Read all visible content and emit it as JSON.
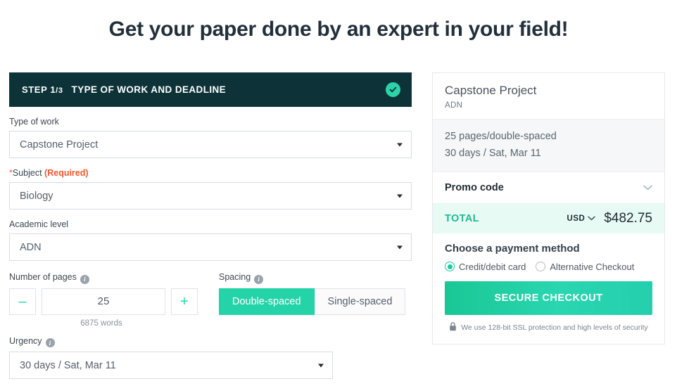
{
  "page": {
    "headline": "Get your paper done by an expert in your field!"
  },
  "step": {
    "number_label": "STEP 1",
    "number_frac": "/3",
    "title": "TYPE OF WORK AND DEADLINE",
    "status_icon": "check-circle-icon",
    "bar_color": "#0d3338",
    "accent_color": "#2ad3a9"
  },
  "form": {
    "type_of_work": {
      "label": "Type of work",
      "value": "Capstone Project"
    },
    "subject": {
      "label_star": "*",
      "label": "Subject ",
      "required_text": "(Required)",
      "value": "Biology",
      "required_color": "#f0592b"
    },
    "academic_level": {
      "label": "Academic level",
      "value": "ADN"
    },
    "pages": {
      "label": "Number of pages",
      "info_icon": "info-icon",
      "decrement": "–",
      "increment": "+",
      "value": "25",
      "words": "6875 words"
    },
    "spacing": {
      "label": "Spacing",
      "info_icon": "info-icon",
      "options": [
        {
          "label": "Double-spaced",
          "selected": true
        },
        {
          "label": "Single-spaced",
          "selected": false
        }
      ],
      "active_color": "#24d4a8"
    },
    "urgency": {
      "label": "Urgency",
      "info_icon": "info-icon",
      "value": "30 days / Sat, Mar 11"
    }
  },
  "summary": {
    "title": "Capstone Project",
    "subtitle": "ADN",
    "detail_line_1": "25 pages/double-spaced",
    "detail_line_2": "30 days / Sat, Mar 11",
    "promo": {
      "label": "Promo code",
      "chevron_icon": "chevron-down-icon"
    },
    "total": {
      "label": "TOTAL",
      "currency": "USD",
      "currency_chevron_icon": "chevron-down-icon",
      "amount": "$482.75",
      "label_color": "#1fb994",
      "row_bg": "#e8faf4"
    },
    "payment": {
      "title": "Choose a payment method",
      "options": [
        {
          "label": "Credit/debit card",
          "selected": true
        },
        {
          "label": "Alternative Checkout",
          "selected": false
        }
      ]
    },
    "checkout_button": "SECURE CHECKOUT",
    "ssl_icon": "lock-icon",
    "ssl_text": "We use 128-bit SSL protection and high levels of security"
  }
}
